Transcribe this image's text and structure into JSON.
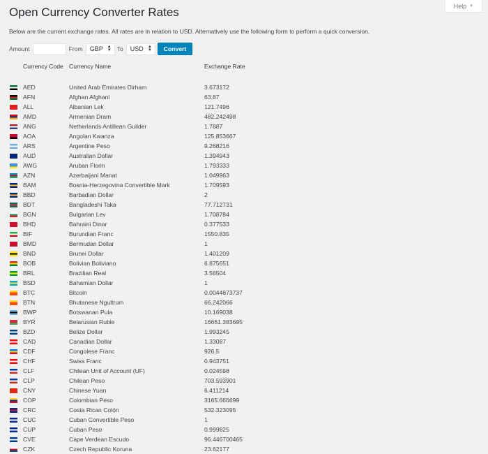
{
  "help": {
    "label": "Help",
    "icon": "caret-down-icon"
  },
  "page": {
    "title": "Open Currency Converter Rates",
    "intro": "Below are the current exchange rates. All rates are in relation to USD. Alternatively use the following form to perform a quick conversion."
  },
  "form": {
    "amount_label": "Amount",
    "amount_value": "",
    "from_label": "From",
    "from_value": "GBP",
    "to_label": "To",
    "to_value": "USD",
    "convert_label": "Convert",
    "convert_color": "#0085ba"
  },
  "table": {
    "headers": {
      "code": "Currency Code",
      "name": "Currency Name",
      "rate": "Exchange Rate"
    },
    "rows": [
      {
        "code": "AED",
        "name": "United Arab Emirates Dirham",
        "rate": "3.673172",
        "flag": [
          "#00732f",
          "#ffffff",
          "#000000"
        ]
      },
      {
        "code": "AFN",
        "name": "Afghan Afghani",
        "rate": "63.87",
        "flag": [
          "#000000",
          "#d32011",
          "#007a36"
        ]
      },
      {
        "code": "ALL",
        "name": "Albanian Lek",
        "rate": "121.7496",
        "flag": [
          "#e41e20",
          "#e41e20",
          "#e41e20"
        ]
      },
      {
        "code": "AMD",
        "name": "Armenian Dram",
        "rate": "482.242498",
        "flag": [
          "#d90012",
          "#0033a0",
          "#f2a800"
        ]
      },
      {
        "code": "ANG",
        "name": "Netherlands Antillean Guilder",
        "rate": "1.7887",
        "flag": [
          "#ae1c28",
          "#ffffff",
          "#21468b"
        ]
      },
      {
        "code": "AOA",
        "name": "Angolan Kwanza",
        "rate": "125.853667",
        "flag": [
          "#cc092f",
          "#cc092f",
          "#000000"
        ]
      },
      {
        "code": "ARS",
        "name": "Argentine Peso",
        "rate": "9.268216",
        "flag": [
          "#74acdf",
          "#ffffff",
          "#74acdf"
        ]
      },
      {
        "code": "AUD",
        "name": "Australian Dollar",
        "rate": "1.394943",
        "flag": [
          "#00247d",
          "#00247d",
          "#00247d"
        ]
      },
      {
        "code": "AWG",
        "name": "Aruban Florin",
        "rate": "1.793333",
        "flag": [
          "#418fde",
          "#418fde",
          "#f9e814"
        ]
      },
      {
        "code": "AZN",
        "name": "Azerbaijani Manat",
        "rate": "1.049963",
        "flag": [
          "#0092bc",
          "#e4002b",
          "#00af66"
        ]
      },
      {
        "code": "BAM",
        "name": "Bosnia-Herzegovina Convertible Mark",
        "rate": "1.709593",
        "flag": [
          "#002395",
          "#fecb00",
          "#002395"
        ]
      },
      {
        "code": "BBD",
        "name": "Barbadian Dollar",
        "rate": "2",
        "flag": [
          "#00267f",
          "#ffc726",
          "#00267f"
        ]
      },
      {
        "code": "BDT",
        "name": "Bangladeshi Taka",
        "rate": "77.712731",
        "flag": [
          "#006a4e",
          "#f42a41",
          "#006a4e"
        ]
      },
      {
        "code": "BGN",
        "name": "Bulgarian Lev",
        "rate": "1.708784",
        "flag": [
          "#ffffff",
          "#00966e",
          "#d62612"
        ]
      },
      {
        "code": "BHD",
        "name": "Bahraini Dinar",
        "rate": "0.377533",
        "flag": [
          "#ce1126",
          "#ce1126",
          "#ce1126"
        ]
      },
      {
        "code": "BIF",
        "name": "Burundian Franc",
        "rate": "1550.835",
        "flag": [
          "#1eb53a",
          "#ffffff",
          "#ce1126"
        ]
      },
      {
        "code": "BMD",
        "name": "Bermudan Dollar",
        "rate": "1",
        "flag": [
          "#c8102e",
          "#c8102e",
          "#c8102e"
        ]
      },
      {
        "code": "BND",
        "name": "Brunei Dollar",
        "rate": "1.401209",
        "flag": [
          "#f7e017",
          "#000000",
          "#f7e017"
        ]
      },
      {
        "code": "BOB",
        "name": "Bolivian Boliviano",
        "rate": "6.875651",
        "flag": [
          "#d52b1e",
          "#f9e300",
          "#007934"
        ]
      },
      {
        "code": "BRL",
        "name": "Brazilian Real",
        "rate": "3.56504",
        "flag": [
          "#009c3b",
          "#ffdf00",
          "#009c3b"
        ]
      },
      {
        "code": "BSD",
        "name": "Bahamian Dollar",
        "rate": "1",
        "flag": [
          "#00abc9",
          "#fae042",
          "#00abc9"
        ]
      },
      {
        "code": "BTC",
        "name": "Bitcoin",
        "rate": "0.0044873737",
        "flag": [
          "#ffd520",
          "#ff4e12",
          "#ff4e12"
        ]
      },
      {
        "code": "BTN",
        "name": "Bhutanese Ngultrum",
        "rate": "66.242066",
        "flag": [
          "#ffd520",
          "#ff4e12",
          "#ff4e12"
        ]
      },
      {
        "code": "BWP",
        "name": "Botswanan Pula",
        "rate": "10.169038",
        "flag": [
          "#75aadb",
          "#000000",
          "#75aadb"
        ]
      },
      {
        "code": "BYR",
        "name": "Belarusian Ruble",
        "rate": "16661.383695",
        "flag": [
          "#c8313e",
          "#c8313e",
          "#4aa657"
        ]
      },
      {
        "code": "BZD",
        "name": "Belize Dollar",
        "rate": "1.993245",
        "flag": [
          "#003f87",
          "#ffffff",
          "#003f87"
        ]
      },
      {
        "code": "CAD",
        "name": "Canadian Dollar",
        "rate": "1.33087",
        "flag": [
          "#ff0000",
          "#ffffff",
          "#ff0000"
        ]
      },
      {
        "code": "CDF",
        "name": "Congolese Franc",
        "rate": "926.5",
        "flag": [
          "#007fff",
          "#f7d618",
          "#ce1021"
        ]
      },
      {
        "code": "CHF",
        "name": "Swiss Franc",
        "rate": "0.943751",
        "flag": [
          "#ff0000",
          "#ffffff",
          "#ff0000"
        ]
      },
      {
        "code": "CLF",
        "name": "Chilean Unit of Account (UF)",
        "rate": "0.024598",
        "flag": [
          "#0039a6",
          "#ffffff",
          "#d52b1e"
        ]
      },
      {
        "code": "CLP",
        "name": "Chilean Peso",
        "rate": "703.593901",
        "flag": [
          "#0039a6",
          "#ffffff",
          "#d52b1e"
        ]
      },
      {
        "code": "CNY",
        "name": "Chinese Yuan",
        "rate": "6.411214",
        "flag": [
          "#de2910",
          "#de2910",
          "#de2910"
        ]
      },
      {
        "code": "COP",
        "name": "Colombian Peso",
        "rate": "3165.666699",
        "flag": [
          "#fcd116",
          "#003893",
          "#ce1126"
        ]
      },
      {
        "code": "CRC",
        "name": "Costa Rican Colón",
        "rate": "532.323095",
        "flag": [
          "#002b7f",
          "#ce1126",
          "#002b7f"
        ]
      },
      {
        "code": "CUC",
        "name": "Cuban Convertible Peso",
        "rate": "1",
        "flag": [
          "#002a8f",
          "#ffffff",
          "#002a8f"
        ]
      },
      {
        "code": "CUP",
        "name": "Cuban Peso",
        "rate": "0.999825",
        "flag": [
          "#002a8f",
          "#ffffff",
          "#002a8f"
        ]
      },
      {
        "code": "CVE",
        "name": "Cape Verdean Escudo",
        "rate": "96.446700465",
        "flag": [
          "#003893",
          "#ffffff",
          "#003893"
        ]
      },
      {
        "code": "CZK",
        "name": "Czech Republic Koruna",
        "rate": "23.62177",
        "flag": [
          "#ffffff",
          "#d7141a",
          "#11457e"
        ]
      }
    ]
  }
}
